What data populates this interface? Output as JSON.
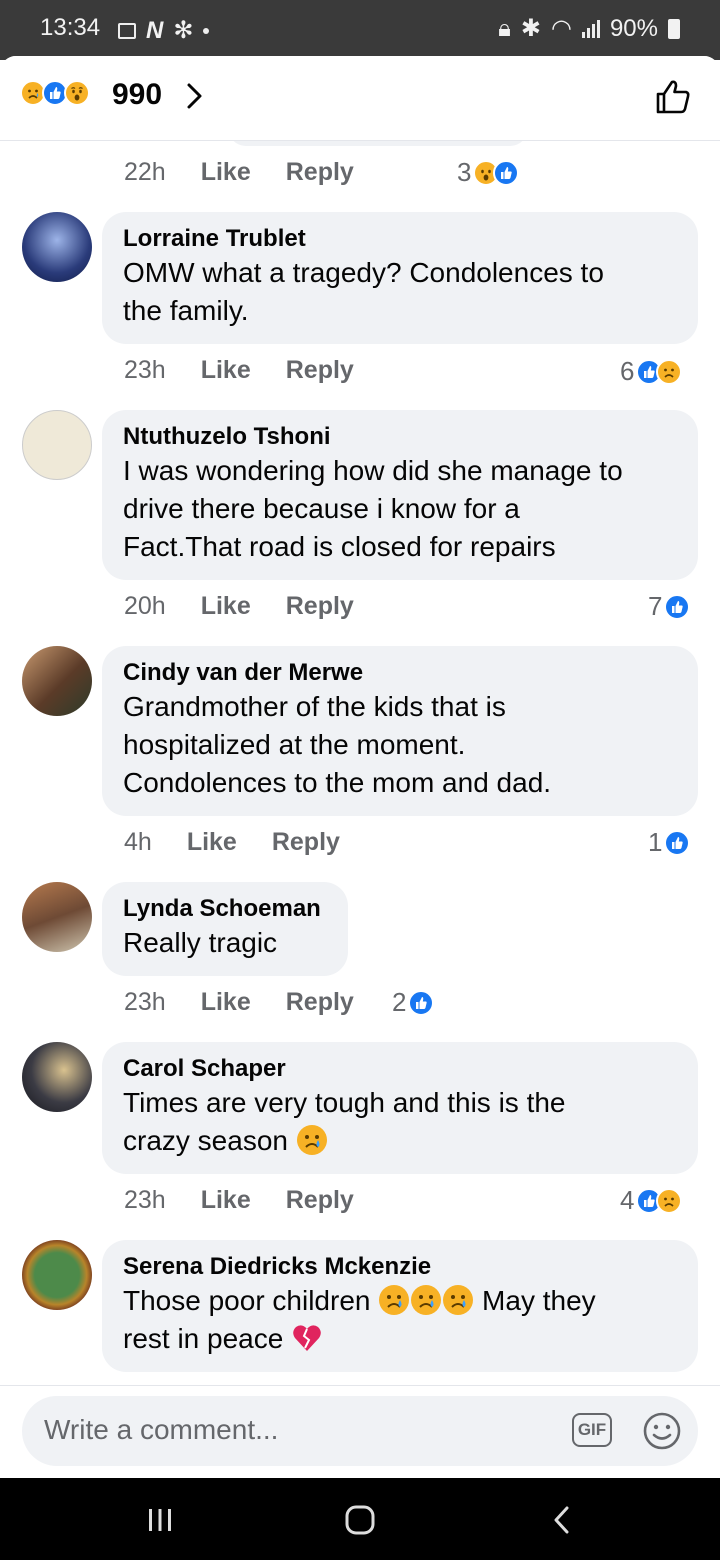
{
  "status_bar": {
    "time": "13:34",
    "battery": "90%"
  },
  "header": {
    "reaction_count": "990"
  },
  "top_comment_meta": {
    "time": "22h",
    "like": "Like",
    "reply": "Reply",
    "reaction_count": "3"
  },
  "comments": [
    {
      "name": "Lorraine Trublet",
      "lines": [
        "OMW what a tragedy? Condolences to",
        "the family."
      ],
      "time": "23h",
      "like": "Like",
      "reply": "Reply",
      "reaction_count": "6"
    },
    {
      "name": "Ntuthuzelo Tshoni",
      "lines": [
        "I was wondering how did she manage to",
        "drive there because i know for a",
        "Fact.That road is closed for repairs"
      ],
      "time": "20h",
      "like": "Like",
      "reply": "Reply",
      "reaction_count": "7"
    },
    {
      "name": "Cindy van der Merwe",
      "lines": [
        "Grandmother of the kids that is",
        "hospitalized at the moment.",
        "Condolences to the mom and dad."
      ],
      "time": "4h",
      "like": "Like",
      "reply": "Reply",
      "reaction_count": "1"
    },
    {
      "name": "Lynda Schoeman",
      "lines": [
        "Really tragic"
      ],
      "time": "23h",
      "like": "Like",
      "reply": "Reply",
      "reaction_count": "2"
    },
    {
      "name": "Carol Schaper",
      "lines": [
        "Times are very tough and this is the",
        "crazy season"
      ],
      "time": "23h",
      "like": "Like",
      "reply": "Reply",
      "reaction_count": "4"
    },
    {
      "name": "Serena Diedricks Mckenzie",
      "lines": [
        "Those poor children",
        "May they",
        "rest in peace"
      ]
    }
  ],
  "composer": {
    "placeholder": "Write a comment...",
    "gif_label": "GIF"
  },
  "colors": {
    "like_blue": "#1877f2",
    "emoji_yellow": "#f7b125",
    "bubble_gray": "#f0f2f5",
    "meta_gray": "#65676b"
  },
  "icons": [
    "sad-react-icon",
    "like-react-icon",
    "wow-react-icon",
    "chevron-right-icon",
    "thumbs-up-icon",
    "gif-icon",
    "smiley-icon",
    "heart-broken-icon"
  ]
}
